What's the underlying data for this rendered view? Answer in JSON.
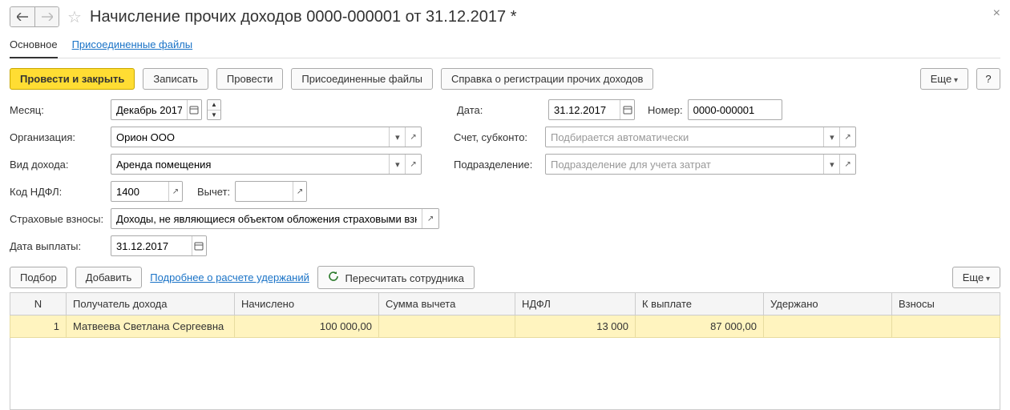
{
  "header": {
    "title": "Начисление прочих доходов 0000-000001 от 31.12.2017 *"
  },
  "tabs": {
    "main": "Основное",
    "files": "Присоединенные файлы"
  },
  "toolbar": {
    "post_close": "Провести и закрыть",
    "save": "Записать",
    "post": "Провести",
    "attached": "Присоединенные файлы",
    "cert": "Справка о регистрации прочих доходов",
    "more": "Еще",
    "help": "?"
  },
  "form": {
    "month_label": "Месяц:",
    "month_value": "Декабрь 2017",
    "org_label": "Организация:",
    "org_value": "Орион ООО",
    "income_type_label": "Вид дохода:",
    "income_type_value": "Аренда помещения",
    "ndfl_code_label": "Код НДФЛ:",
    "ndfl_code_value": "1400",
    "deduction_label": "Вычет:",
    "deduction_value": "",
    "insurance_label": "Страховые взносы:",
    "insurance_value": "Доходы, не являющиеся объектом обложения страховыми взно",
    "pay_date_label": "Дата выплаты:",
    "pay_date_value": "31.12.2017",
    "date_label": "Дата:",
    "date_value": "31.12.2017",
    "number_label": "Номер:",
    "number_value": "0000-000001",
    "account_label": "Счет, субконто:",
    "account_placeholder": "Подбирается автоматически",
    "dept_label": "Подразделение:",
    "dept_placeholder": "Подразделение для учета затрат"
  },
  "table_toolbar": {
    "pick": "Подбор",
    "add": "Добавить",
    "details": "Подробнее о расчете удержаний",
    "recalc": "Пересчитать сотрудника",
    "more": "Еще"
  },
  "grid": {
    "headers": {
      "n": "N",
      "recipient": "Получатель дохода",
      "accrued": "Начислено",
      "deduction": "Сумма вычета",
      "ndfl": "НДФЛ",
      "to_pay": "К выплате",
      "withheld": "Удержано",
      "contrib": "Взносы"
    },
    "rows": [
      {
        "n": "1",
        "recipient": "Матвеева Светлана Сергеевна",
        "accrued": "100 000,00",
        "deduction": "",
        "ndfl": "13 000",
        "to_pay": "87 000,00",
        "withheld": "",
        "contrib": ""
      }
    ]
  }
}
